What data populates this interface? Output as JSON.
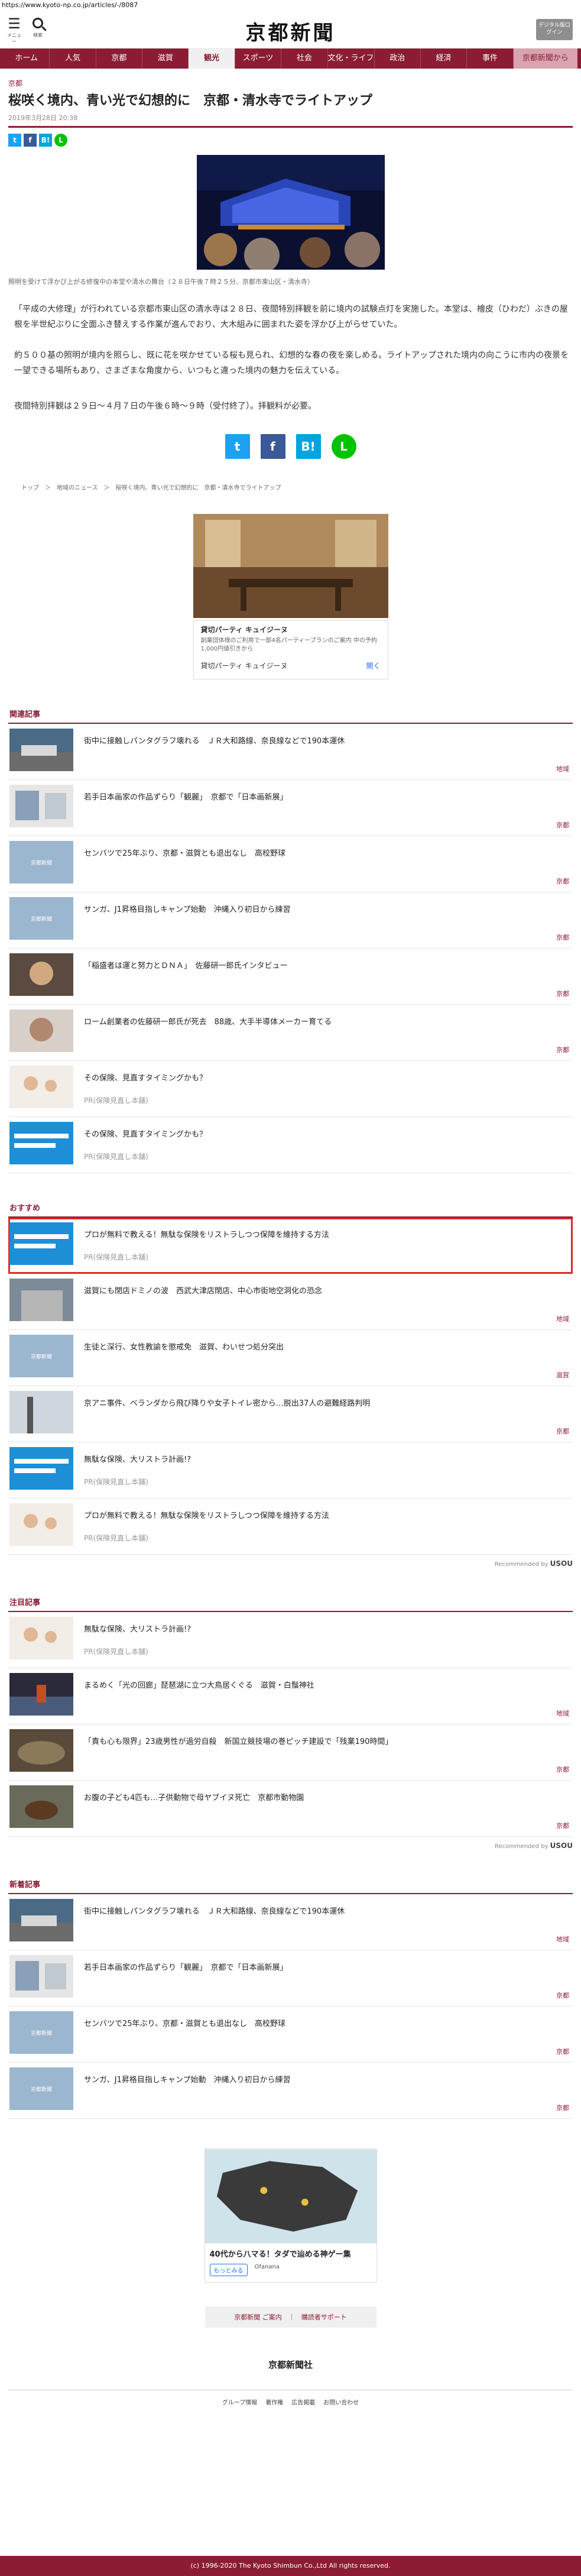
{
  "browser": {
    "url": "https://www.kyoto-np.co.jp/articles/-/8087"
  },
  "header": {
    "menu_label": "メニュー",
    "search_label": "検索",
    "logo": "京都新聞",
    "digital_label": "デジタル版ログイン"
  },
  "nav": [
    "ホーム",
    "人気",
    "京都",
    "滋賀",
    "観光",
    "スポーツ",
    "社会",
    "文化・ライフ",
    "政治",
    "経済",
    "事件",
    "京都新聞から"
  ],
  "article": {
    "section": "京都",
    "title": "桜咲く境内、青い光で幻想的に　京都・清水寺でライトアップ",
    "date": "2019年3月28日 20:38",
    "caption": "照明を受けて浮かび上がる修復中の本堂や清水の舞台（２８日午後７時２５分、京都市東山区・清水寺）",
    "p1": "「平成の大修理」が行われている京都市東山区の清水寺は２８日、夜間特別拝観を前に境内の試験点灯を実施した。本堂は、檜皮（ひわだ）ぶきの屋根を半世紀ぶりに全面ふき替えする作業が進んでおり、大木組みに囲まれた姿を浮かび上がらせていた。",
    "p2": "約５００基の照明が境内を照らし、既に花を咲かせている桜も見られ、幻想的な春の夜を楽しめる。ライトアップされた境内の向こうに市内の夜景を一望できる場所もあり、さまざまな角度から、いつもと違った境内の魅力を伝えている。",
    "p3": "夜間特別拝観は２９日～４月７日の午後６時～９時（受付終了）。拝観料が必要。",
    "breadcrumb": "トップ　＞　地域のニュース　＞　桜咲く境内、青い光で幻想的に　京都・清水寺でライトアップ"
  },
  "share": {
    "twitter": "t",
    "facebook": "f",
    "hatena": "B!",
    "line": "L"
  },
  "ad_top": {
    "name": "貸切パーティ キュイジーヌ",
    "sub": "創業団体様のご利用で一部4名パーティープランのご案内 中の予約1,000円値引きから",
    "footer": "貸切パーティ キュイジーヌ",
    "open": "開く"
  },
  "related": {
    "heading": "関連記事",
    "items": [
      {
        "title": "街中に接触しパンタグラフ壊れる　ＪＲ大和路線、奈良線などで190本運休",
        "cat": "地域"
      },
      {
        "title": "若手日本画家の作品ずらり「観麗」　京都で「日本画新展」",
        "cat": "京都"
      },
      {
        "title": "センバツで25年ぶり、京都・滋賀とも退出なし　高校野球",
        "cat": "京都"
      },
      {
        "title": "サンガ、J1昇格目指しキャンプ始動　沖縄入り初日から練習",
        "cat": "京都"
      },
      {
        "title": "「稲盛者は運と努力とＤＮＡ」　佐藤研一郎氏インタビュー",
        "cat": "京都"
      },
      {
        "title": "ローム創業者の佐藤研一郎氏が死去　88歳、大手半導体メーカー育てる",
        "cat": "京都"
      },
      {
        "title": "その保険、見直すタイミングかも？",
        "pr": "PR(保険見直し本舗)"
      },
      {
        "title": "その保険、見直すタイミングかも？",
        "pr": "PR(保険見直し本舗)"
      }
    ]
  },
  "recommend": {
    "heading": "おすすめ",
    "items": [
      {
        "title": "プロが無料で教える！無駄な保険をリストラしつつ保障を維持する方法",
        "pr": "PR(保険見直し本舗)"
      },
      {
        "title": "滋賀にも閉店ドミノの波　西武大津店閉店、中心市街地空洞化の恐念",
        "cat": "地域"
      },
      {
        "title": "生徒と深行、女性教諭を懲戒免　滋賀、わいせつ処分突出",
        "cat": "滋賀"
      },
      {
        "title": "京アニ事件、ベランダから飛び降りや女子トイレ密から…脱出37人の避難経路判明",
        "cat": "京都"
      },
      {
        "title": "無駄な保険、大リストラ計画!?",
        "pr": "PR(保険見直し本舗)"
      },
      {
        "title": "プロが無料で教える！無駄な保険をリストラしつつ保障を維持する方法",
        "pr": "PR(保険見直し本舗)"
      }
    ],
    "by": "Recommended by",
    "brand": "USOU"
  },
  "featured": {
    "heading": "注目記事",
    "items": [
      {
        "title": "無駄な保険、大リストラ計画!?",
        "pr": "PR(保険見直し本舗)"
      },
      {
        "title": "まるめく「光の回廊」琵琶湖に立つ大鳥居くぐる　滋賀・白鬚神社",
        "cat": "地域"
      },
      {
        "title": "「責も心も限界」23歳男性が過労自殺　新国立競技場の巻ピッチ建設で「残業190時間」",
        "cat": "京都"
      },
      {
        "title": "お腹の子ども4匹も…子供動物で母ヤブイヌ死亡　京都市動物園",
        "cat": "京都"
      }
    ],
    "by": "Recommended by",
    "brand": "USOU"
  },
  "latest": {
    "heading": "新着記事",
    "items": [
      {
        "title": "街中に接触しパンタグラフ壊れる　ＪＲ大和路線、奈良線などで190本運休",
        "cat": "地域"
      },
      {
        "title": "若手日本画家の作品ずらり「観麗」　京都で「日本画新展」",
        "cat": "京都"
      },
      {
        "title": "センバツで25年ぶり、京都・滋賀とも退出なし　高校野球",
        "cat": "京都"
      },
      {
        "title": "サンガ、J1昇格目指しキャンプ始動　沖縄入り初日から練習",
        "cat": "京都"
      }
    ]
  },
  "ad_bottom": {
    "caption": "40代から八マる！タダで辿める神ゲー集",
    "btn": "もっとみる",
    "brand": "Ofanana"
  },
  "footer": {
    "links": "京都新聞 ご案内　｜　購読者サポート",
    "logo": "京都新聞社",
    "nav": [
      "グループ情報",
      "著作権",
      "広告掲載",
      "お問い合わせ"
    ],
    "copyright": "(c) 1996-2020 The Kyoto Shimbun Co.,Ltd All rights reserved."
  },
  "colors": {
    "brand": "#8b1c33",
    "twitter": "#1da1f2",
    "facebook": "#3b5998",
    "hatena": "#00a4de",
    "line": "#00c300",
    "alert": "#e2262b"
  }
}
